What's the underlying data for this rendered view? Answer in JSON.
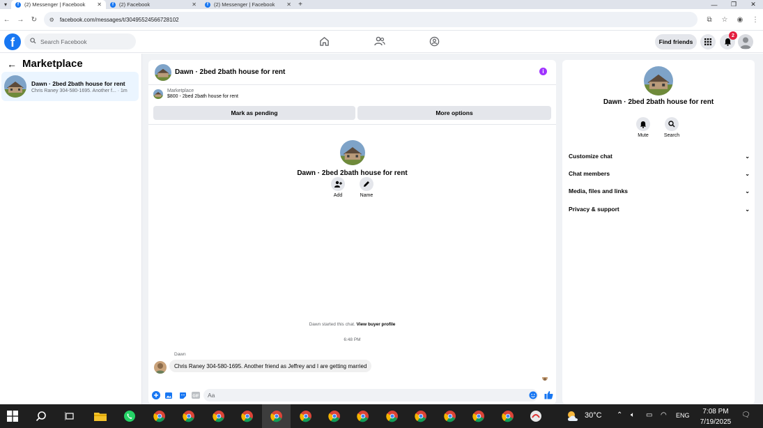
{
  "browser": {
    "tabs": [
      {
        "title": "(2) Messenger | Facebook",
        "active": true
      },
      {
        "title": "(2) Facebook",
        "active": false
      },
      {
        "title": "(2) Messenger | Facebook",
        "active": false
      }
    ],
    "url": "facebook.com/messages/t/30495524566728102"
  },
  "fb_nav": {
    "search_placeholder": "Search Facebook",
    "find_friends": "Find friends",
    "notification_count": "2"
  },
  "left": {
    "title": "Marketplace",
    "conversation": {
      "name": "Dawn · 2bed 2bath house for rent",
      "preview": "Chris Raney 304-580-1695. Another f... · 1m"
    }
  },
  "chat": {
    "header_title": "Dawn · 2bed 2bath house for rent",
    "marketplace_label": "Marketplace",
    "listing": "$800 - 2bed 2bath house for rent",
    "mark_pending": "Mark as pending",
    "more_options": "More options",
    "intro_title": "Dawn · 2bed 2bath house for rent",
    "add_label": "Add",
    "name_label": "Name",
    "started_text": "Dawn started this chat.",
    "view_profile": "View buyer profile",
    "timestamp": "6:48 PM",
    "sender": "Dawn",
    "message": "Chris Raney 304-580-1695. Another friend as  Jeffrey and I are getting married",
    "composer_placeholder": "Aa"
  },
  "right": {
    "title": "Dawn · 2bed 2bath house for rent",
    "mute_label": "Mute",
    "search_label": "Search",
    "sections": [
      "Customize chat",
      "Chat members",
      "Media, files and links",
      "Privacy & support"
    ]
  },
  "taskbar": {
    "temperature": "30°C",
    "language": "ENG",
    "time": "7:08 PM",
    "date": "7/19/2025"
  },
  "colors": {
    "fb_blue": "#1877f2",
    "selected_convo": "#ebf5ff",
    "info_purple": "#a033ff",
    "badge_red": "#e41e3f"
  }
}
